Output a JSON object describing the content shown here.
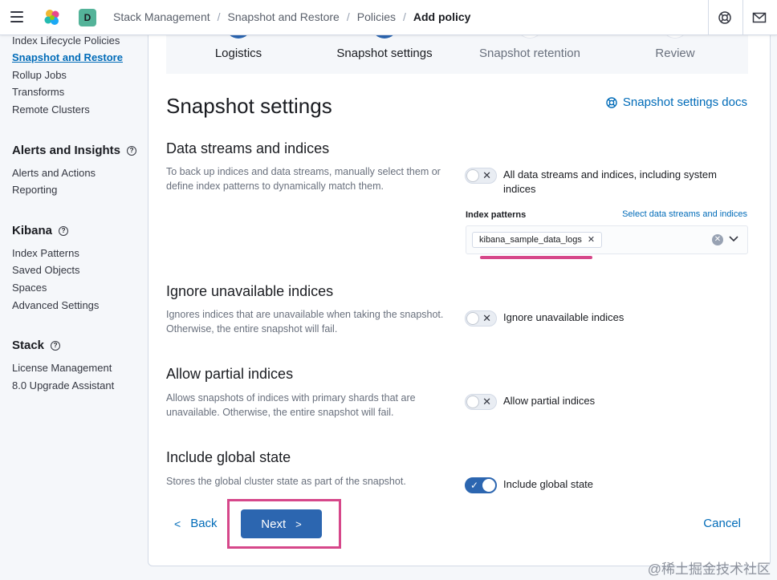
{
  "header": {
    "space_initial": "D",
    "breadcrumbs": [
      "Stack Management",
      "Snapshot and Restore",
      "Policies",
      "Add policy"
    ]
  },
  "sidebar": {
    "items_top": [
      "Index Lifecycle Policies",
      "Snapshot and Restore",
      "Rollup Jobs",
      "Transforms",
      "Remote Clusters"
    ],
    "alerts_title": "Alerts and Insights",
    "alerts_items": [
      "Alerts and Actions",
      "Reporting"
    ],
    "kibana_title": "Kibana",
    "kibana_items": [
      "Index Patterns",
      "Saved Objects",
      "Spaces",
      "Advanced Settings"
    ],
    "stack_title": "Stack",
    "stack_items": [
      "License Management",
      "8.0 Upgrade Assistant"
    ]
  },
  "steps": [
    "Logistics",
    "Snapshot settings",
    "Snapshot retention",
    "Review"
  ],
  "page": {
    "title": "Snapshot settings",
    "docs_link": "Snapshot settings docs"
  },
  "sections": {
    "data_streams": {
      "title": "Data streams and indices",
      "description": "To back up indices and data streams, manually select them or define index patterns to dynamically match them.",
      "toggle_label": "All data streams and indices, including system indices",
      "toggle_on": false,
      "index_patterns_label": "Index patterns",
      "select_link": "Select data streams and indices",
      "chip": "kibana_sample_data_logs"
    },
    "ignore_unavailable": {
      "title": "Ignore unavailable indices",
      "description": "Ignores indices that are unavailable when taking the snapshot. Otherwise, the entire snapshot will fail.",
      "toggle_label": "Ignore unavailable indices",
      "toggle_on": false
    },
    "partial": {
      "title": "Allow partial indices",
      "description": "Allows snapshots of indices with primary shards that are unavailable. Otherwise, the entire snapshot will fail.",
      "toggle_label": "Allow partial indices",
      "toggle_on": false
    },
    "global_state": {
      "title": "Include global state",
      "description": "Stores the global cluster state as part of the snapshot.",
      "toggle_label": "Include global state",
      "toggle_on": true
    }
  },
  "footer": {
    "back": "Back",
    "next": "Next",
    "cancel": "Cancel"
  },
  "watermark": "@稀土掘金技术社区",
  "colors": {
    "accent": "#2c66b0",
    "link": "#006bb8",
    "highlight": "#d6478a"
  }
}
